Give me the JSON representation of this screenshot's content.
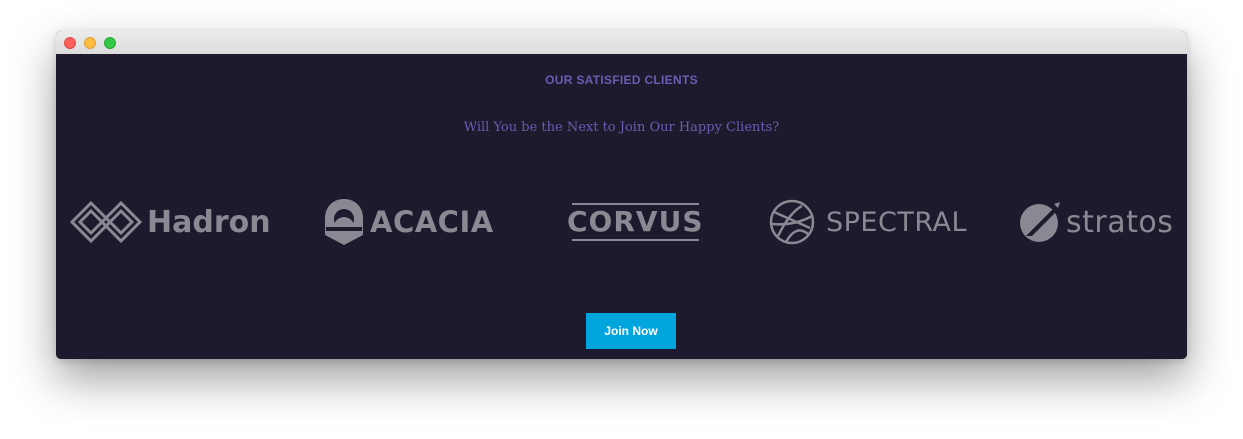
{
  "window": {
    "controls": [
      "close-icon",
      "minimize-icon",
      "maximize-icon"
    ]
  },
  "clients": {
    "eyebrow": "OUR SATISFIED CLIENTS",
    "subtitle": "Will You be the Next to Join Our Happy Clients?",
    "logos": [
      {
        "name": "Hadron",
        "icon": "hadron-logo-icon"
      },
      {
        "name": "ACACIA",
        "icon": "acacia-logo-icon"
      },
      {
        "name": "CORVUS",
        "icon": "corvus-logo-icon"
      },
      {
        "name": "SPECTRAL",
        "icon": "spectral-logo-icon"
      },
      {
        "name": "stratos",
        "icon": "stratos-logo-icon"
      }
    ],
    "cta_label": "Join Now"
  },
  "colors": {
    "background": "#1e1a2e",
    "heading": "#6a5cb0",
    "logo": "#8b8894",
    "button": "#00a5de",
    "button_text": "#ffffff"
  }
}
